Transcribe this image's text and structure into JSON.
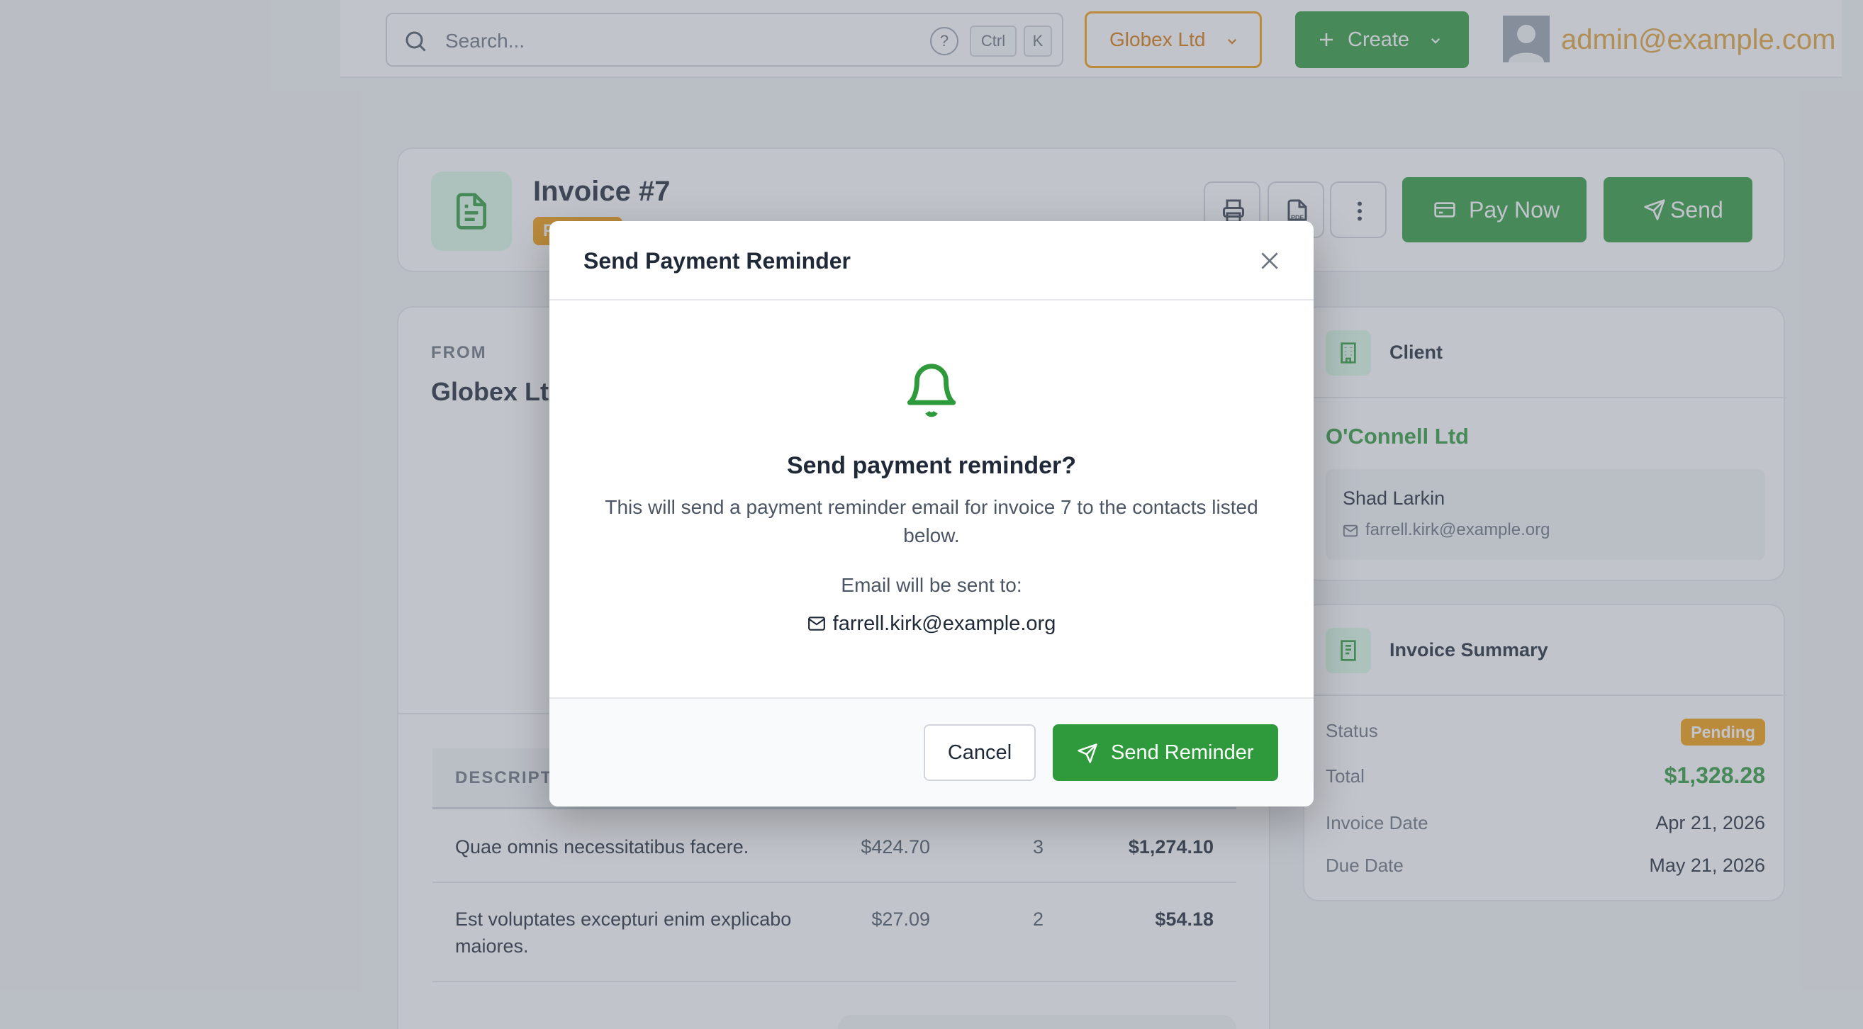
{
  "topbar": {
    "search_placeholder": "Search...",
    "shortcut_ctrl": "Ctrl",
    "shortcut_k": "K",
    "help_glyph": "?",
    "company": "Globex Ltd",
    "create_label": "Create",
    "user_email": "admin@example.com"
  },
  "invoice": {
    "title": "Invoice #7",
    "status_badge": "Pending",
    "pay_now_label": "Pay Now",
    "send_label": "Send",
    "from_label": "FROM",
    "from_name": "Globex Ltd",
    "table_header": "DESCRIPTION",
    "items": [
      {
        "description": "Quae omnis necessitatibus facere.",
        "price": "$424.70",
        "qty": "3",
        "amount": "$1,274.10"
      },
      {
        "description": "Est voluptates excepturi enim explicabo maiores.",
        "price": "$27.09",
        "qty": "2",
        "amount": "$54.18"
      }
    ]
  },
  "client": {
    "title": "Client",
    "name": "O'Connell Ltd",
    "contact_name": "Shad Larkin",
    "contact_email": "farrell.kirk@example.org"
  },
  "summary": {
    "title": "Invoice Summary",
    "status_label": "Status",
    "status_value": "Pending",
    "total_label": "Total",
    "total_value": "$1,328.28",
    "invoice_date_label": "Invoice Date",
    "invoice_date_value": "Apr 21, 2026",
    "due_date_label": "Due Date",
    "due_date_value": "May 21, 2026"
  },
  "modal": {
    "title": "Send Payment Reminder",
    "heading": "Send payment reminder?",
    "body": "This will send a payment reminder email for invoice 7 to the contacts listed below.",
    "sent_to_label": "Email will be sent to:",
    "recipient": "farrell.kirk@example.org",
    "cancel_label": "Cancel",
    "send_label": "Send Reminder"
  },
  "colors": {
    "accent_green": "#2e9a3c",
    "warning_amber": "#f59e0b"
  },
  "icons": [
    "search-icon",
    "help-icon",
    "chevron-down-icon",
    "plus-icon",
    "avatar",
    "document-icon",
    "printer-icon",
    "pdf-icon",
    "more-vertical-icon",
    "credit-card-icon",
    "send-icon",
    "building-icon",
    "receipt-icon",
    "mail-icon",
    "bell-icon",
    "close-icon"
  ]
}
